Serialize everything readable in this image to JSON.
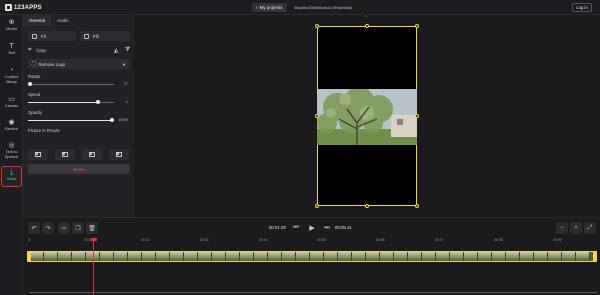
{
  "header": {
    "logo": "123APPS",
    "my_projects": "My projects",
    "file_id": "58ac8e1f38f4f6c6c4c7ff9ae4d6a",
    "login": "Log in"
  },
  "nav": {
    "items": [
      {
        "icon": "plus-circle-icon",
        "glyph": "⊕",
        "label": "Media"
      },
      {
        "icon": "text-icon",
        "glyph": "T",
        "label": "Text"
      },
      {
        "icon": "content-library-icon",
        "glyph": "◔",
        "label": "Content library"
      },
      {
        "icon": "canvas-icon",
        "glyph": "▭",
        "label": "Canvas"
      },
      {
        "icon": "record-icon",
        "glyph": "◉",
        "label": "Record"
      },
      {
        "icon": "text-to-speech-icon",
        "glyph": "◎",
        "label": "Text to Speech"
      },
      {
        "icon": "save-download-icon",
        "glyph": "⤓",
        "label": "Save"
      }
    ]
  },
  "panel": {
    "tabs": [
      "General",
      "Audio"
    ],
    "fit_label": "Fit",
    "fill_label": "Fill",
    "crop_label": "Crop",
    "remove_logo_label": "Remove Logo",
    "rotate": {
      "label": "Rotate",
      "value": "0°",
      "level": 0
    },
    "speed": {
      "label": "Speed",
      "value": "1",
      "level": 0.82
    },
    "opacity": {
      "label": "Opacity",
      "value": "100%",
      "level": 1
    },
    "pip_label": "Picture in Picture",
    "reset_label": "Reset"
  },
  "timeline": {
    "current_time": "00:01.09",
    "total_time": "00:09.41",
    "ruler_ticks": [
      "0",
      "00:01",
      "00:02",
      "00:03",
      "00:04",
      "00:05",
      "00:06",
      "00:07",
      "00:08",
      "00:09"
    ]
  },
  "colors": {
    "accent_save": "#5fd36a",
    "selection": "#f0d640",
    "playhead": "#e0302e",
    "reset_text": "#e8554f"
  }
}
